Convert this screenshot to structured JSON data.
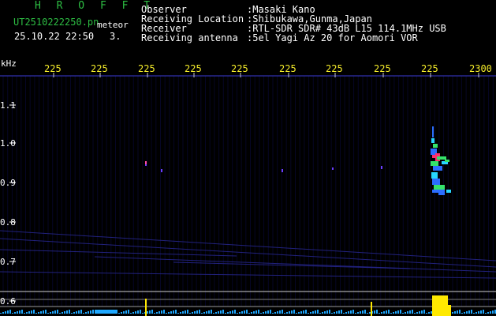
{
  "header": {
    "title": "H R O F F T",
    "file_id": "UT2510222250.pn",
    "type_label": "meteor",
    "date_time": "25.10.22 22:50",
    "count": "3."
  },
  "info": {
    "labels": [
      "Observer",
      "Receiving Location",
      "Receiver",
      "Receiving antenna"
    ],
    "values": [
      ":Masaki Kano",
      ":Shibukawa,Gunma,Japan",
      ":RTL-SDR SDR# 43dB L15 114.1MHz USB",
      ":5el Yagi Az 20 for Aomori VOR"
    ]
  },
  "axis": {
    "unit": "kHz",
    "time_ticks": [
      "225",
      "225",
      "225",
      "225",
      "225",
      "225",
      "225",
      "225",
      "225",
      "2300"
    ],
    "freq_ticks": [
      "1.1",
      "1.0",
      "0.9",
      "0.8",
      "0.7",
      "0.6"
    ]
  },
  "colors": {
    "background": "#000000",
    "grid": "#3b3bd8",
    "tick_text": "#f5ec2a",
    "title": "#2dbd43",
    "info_text": "#ffffff",
    "echo_hot": "#ff2d6e",
    "echo_warm": "#35e36a",
    "echo_cool": "#2b6dff",
    "echo_cyan": "#27d6ff"
  }
}
